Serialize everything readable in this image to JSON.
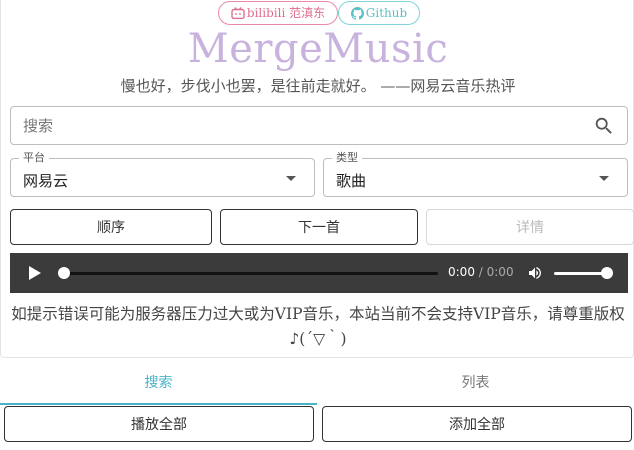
{
  "header": {
    "bilibili_chip": "bilibili 范滇东",
    "github_chip": "Github",
    "logo": "MergeMusic",
    "quote": "慢也好，步伐小也罢，是往前走就好。 ——网易云音乐热评"
  },
  "search": {
    "placeholder": "搜索",
    "value": ""
  },
  "platform_select": {
    "label": "平台",
    "value": "网易云"
  },
  "type_select": {
    "label": "类型",
    "value": "歌曲"
  },
  "controls": {
    "order": "顺序",
    "next": "下一首",
    "detail": "详情"
  },
  "player": {
    "current_time": "0:00",
    "separator": " / ",
    "duration": "0:00",
    "progress": 0,
    "volume": 1.0
  },
  "notice": "如提示错误可能为服务器压力过大或为VIP音乐，本站当前不会支持VIP音乐，请尊重版权♪(´▽｀)",
  "tabs": [
    {
      "label": "搜索",
      "active": true
    },
    {
      "label": "列表",
      "active": false
    }
  ],
  "actions": {
    "play_all": "播放全部",
    "add_all": "添加全部"
  },
  "colors": {
    "accent": "#4ab3c8",
    "logo": "#c8b2de",
    "bilibili": "#e06c8c",
    "github": "#5bbfc5"
  }
}
